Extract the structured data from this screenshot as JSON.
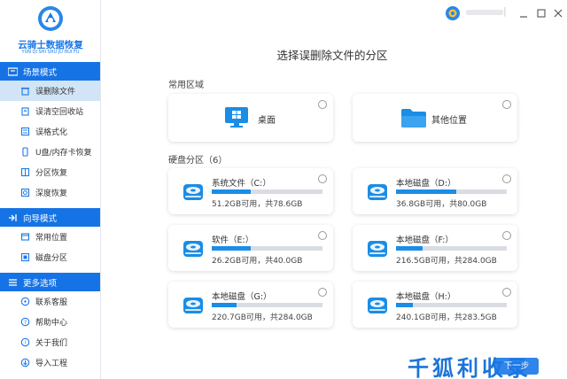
{
  "app": {
    "name": "云骑士数据恢复",
    "name_pinyin": "YUN QI SHI SHU JU HUI FU"
  },
  "sidebar": {
    "sections": [
      {
        "title": "场景模式",
        "items": [
          {
            "label": "误删除文件",
            "icon": "trash-icon"
          },
          {
            "label": "误清空回收站",
            "icon": "recycle-bin-icon"
          },
          {
            "label": "误格式化",
            "icon": "format-icon"
          },
          {
            "label": "U盘/内存卡恢复",
            "icon": "usb-icon"
          },
          {
            "label": "分区恢复",
            "icon": "partition-icon"
          },
          {
            "label": "深度恢复",
            "icon": "deep-scan-icon"
          }
        ]
      },
      {
        "title": "向导模式",
        "items": [
          {
            "label": "常用位置",
            "icon": "location-icon"
          },
          {
            "label": "磁盘分区",
            "icon": "disk-partition-icon"
          }
        ]
      },
      {
        "title": "更多选项",
        "items": [
          {
            "label": "联系客服",
            "icon": "support-icon"
          },
          {
            "label": "帮助中心",
            "icon": "help-icon"
          },
          {
            "label": "关于我们",
            "icon": "info-icon"
          },
          {
            "label": "导入工程",
            "icon": "import-icon"
          }
        ]
      }
    ],
    "active_item": "误删除文件"
  },
  "main": {
    "title": "选择误删除文件的分区",
    "common_label": "常用区域",
    "common": [
      {
        "label": "桌面",
        "icon": "windows-desktop-icon"
      },
      {
        "label": "其他位置",
        "icon": "folder-icon"
      }
    ],
    "disk_label": "硬盘分区（6）",
    "disks": [
      {
        "name": "系统文件（C:）",
        "info": "51.2GB可用，共78.6GB",
        "used_fraction": 0.35
      },
      {
        "name": "本地磁盘（D:）",
        "info": "36.8GB可用，共80.0GB",
        "used_fraction": 0.54
      },
      {
        "name": "软件（E:）",
        "info": "26.2GB可用，共40.0GB",
        "used_fraction": 0.35
      },
      {
        "name": "本地磁盘（F:）",
        "info": "216.5GB可用，共284.0GB",
        "used_fraction": 0.24
      },
      {
        "name": "本地磁盘（G:）",
        "info": "220.7GB可用，共284.0GB",
        "used_fraction": 0.22
      },
      {
        "name": "本地磁盘（H:）",
        "info": "240.1GB可用，共283.5GB",
        "used_fraction": 0.15
      }
    ],
    "next_label": "下一步"
  },
  "watermark": "千狐利收录",
  "colors": {
    "accent": "#1673e6",
    "bar_fill": "#1a8de6",
    "active_bg": "#d2e5f7"
  }
}
